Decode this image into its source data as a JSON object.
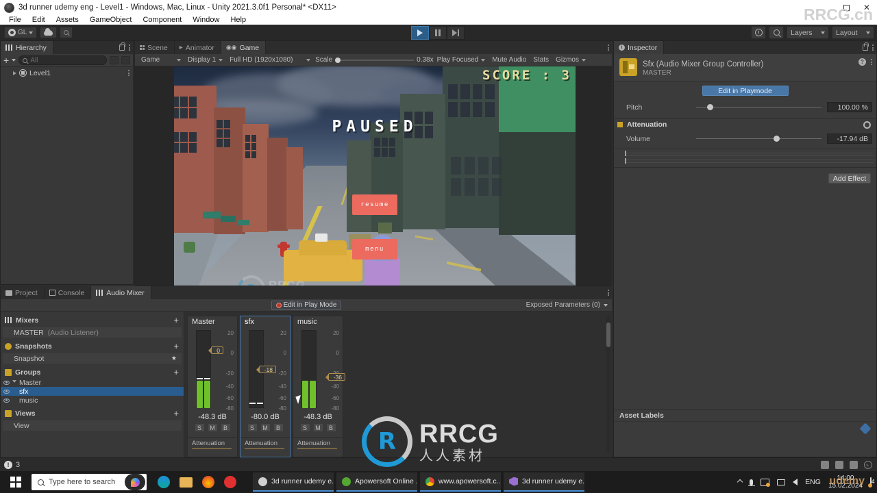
{
  "window": {
    "title": "3d runner udemy eng - Level1 - Windows, Mac, Linux - Unity 2021.3.0f1 Personal* <DX11>",
    "app_icon": "unity-icon",
    "controls": {
      "minimize": "–",
      "maximize": "maximize",
      "close": "✕"
    },
    "watermark_topright": "RRCG.cn"
  },
  "menubar": {
    "items": [
      "File",
      "Edit",
      "Assets",
      "GameObject",
      "Component",
      "Window",
      "Help"
    ]
  },
  "toolbar": {
    "account_label": "GL",
    "cloud_icon": "cloud-icon",
    "services_icon": "services-icon",
    "play": "play-icon",
    "pause": "pause-icon",
    "step": "step-icon",
    "history_icon": "undo-history-icon",
    "search_icon": "search-icon",
    "layers_label": "Layers",
    "layout_label": "Layout"
  },
  "hierarchy": {
    "tab_label": "Hierarchy",
    "add_label": "+",
    "search_placeholder": "All",
    "items": [
      {
        "label": "Level1",
        "icon": "scene-icon"
      }
    ]
  },
  "gameview": {
    "tabs": [
      {
        "label": "Scene",
        "icon": "scene-grid-icon",
        "selected": false
      },
      {
        "label": "Animator",
        "icon": "animator-icon",
        "selected": false
      },
      {
        "label": "Game",
        "icon": "game-icon",
        "selected": true
      }
    ],
    "controls": {
      "mode": "Game",
      "display": "Display 1",
      "resolution": "Full HD (1920x1080)",
      "scale_label": "Scale",
      "scale_value": "0.38x",
      "play_mode": "Play Focused",
      "mute_audio": "Mute Audio",
      "stats": "Stats",
      "gizmos": "Gizmos"
    },
    "hud": {
      "score": "SCORE : 3",
      "paused": "PAUSED",
      "resume_button": "resume",
      "menu_button": "menu"
    }
  },
  "inspector": {
    "tab_label": "Inspector",
    "object_title": "Sfx (Audio Mixer Group Controller)",
    "object_subtitle": "MASTER",
    "edit_playmode_button": "Edit in Playmode",
    "pitch": {
      "label": "Pitch",
      "value": "100.00 %",
      "knob_percent": 9
    },
    "attenuation": {
      "label": "Attenuation",
      "volume_label": "Volume",
      "volume_value": "-17.94 dB",
      "knob_percent": 62
    },
    "add_effect_button": "Add Effect",
    "asset_labels_title": "Asset Labels"
  },
  "mixer": {
    "tabs": [
      {
        "label": "Project",
        "icon": "folder-icon",
        "selected": false
      },
      {
        "label": "Console",
        "icon": "console-icon",
        "selected": false
      },
      {
        "label": "Audio Mixer",
        "icon": "mixer-icon",
        "selected": true
      }
    ],
    "edit_play_mode_button": "Edit in Play Mode",
    "exposed_parameters": "Exposed Parameters (0)",
    "sections": {
      "mixers": {
        "title": "Mixers",
        "add": "+",
        "items": [
          {
            "label": "MASTER",
            "note": "(Audio Listener)"
          }
        ]
      },
      "snapshots": {
        "title": "Snapshots",
        "add": "+",
        "items": [
          {
            "label": "Snapshot",
            "starred": true
          }
        ]
      },
      "groups": {
        "title": "Groups",
        "add": "+",
        "items": [
          {
            "label": "Master",
            "selected": false,
            "indent": 0
          },
          {
            "label": "sfx",
            "selected": true,
            "indent": 1
          },
          {
            "label": "music",
            "selected": false,
            "indent": 1
          }
        ]
      },
      "views": {
        "title": "Views",
        "add": "+",
        "items": [
          {
            "label": "View"
          }
        ]
      }
    },
    "strips": [
      {
        "name": "Master",
        "selected": false,
        "fader_db": "0",
        "db_readout": "-48.3 dB",
        "scale_labels": [
          "20",
          "0",
          "-20",
          "-40",
          "-60",
          "-80"
        ],
        "buttons": [
          "S",
          "M",
          "B"
        ],
        "effect": "Attenuation",
        "meter_level": 42,
        "fader_pos_percent": 26
      },
      {
        "name": "sfx",
        "selected": true,
        "fader_db": "-18",
        "db_readout": "-80.0 dB",
        "scale_labels": [
          "20",
          "0",
          "-20",
          "-40",
          "-60",
          "-80"
        ],
        "buttons": [
          "S",
          "M",
          "B"
        ],
        "effect": "Attenuation",
        "meter_level": 1,
        "fader_pos_percent": 58
      },
      {
        "name": "music",
        "selected": false,
        "fader_db": "-36",
        "db_readout": "-48.3 dB",
        "scale_labels": [
          "20",
          "0",
          "-20",
          "-40",
          "-60",
          "-80"
        ],
        "buttons": [
          "S",
          "M",
          "B"
        ],
        "effect": "Attenuation",
        "meter_level": 42,
        "fader_pos_percent": 71
      }
    ]
  },
  "statusbar": {
    "warning_count": "3"
  },
  "taskbar": {
    "search_placeholder": "Type here to search",
    "copilot_icon": "copilot-icon",
    "pinned": [
      {
        "icon": "edge-icon",
        "name": "edge"
      },
      {
        "icon": "file-explorer-icon",
        "name": "file-explorer"
      },
      {
        "icon": "firefox-icon",
        "name": "firefox"
      },
      {
        "icon": "opera-icon",
        "name": "opera"
      }
    ],
    "apps": [
      {
        "label": "3d runner udemy e...",
        "icon": "unity-icon",
        "active": true
      },
      {
        "label": "Apowersoft Online ...",
        "icon": "apowersoft-icon",
        "active": true
      },
      {
        "label": "www.apowersoft.c...",
        "icon": "chrome-icon",
        "active": true
      },
      {
        "label": "3d runner udemy e...",
        "icon": "visual-studio-icon",
        "active": true
      }
    ],
    "tray": {
      "language": "ENG",
      "time": "14:00",
      "date": "15.02.2024",
      "notification_count": "4"
    }
  },
  "watermarks": {
    "brand": "RRCG",
    "brand_cn": "人人素材",
    "mark_letter": "R",
    "udemy": "udemy"
  }
}
